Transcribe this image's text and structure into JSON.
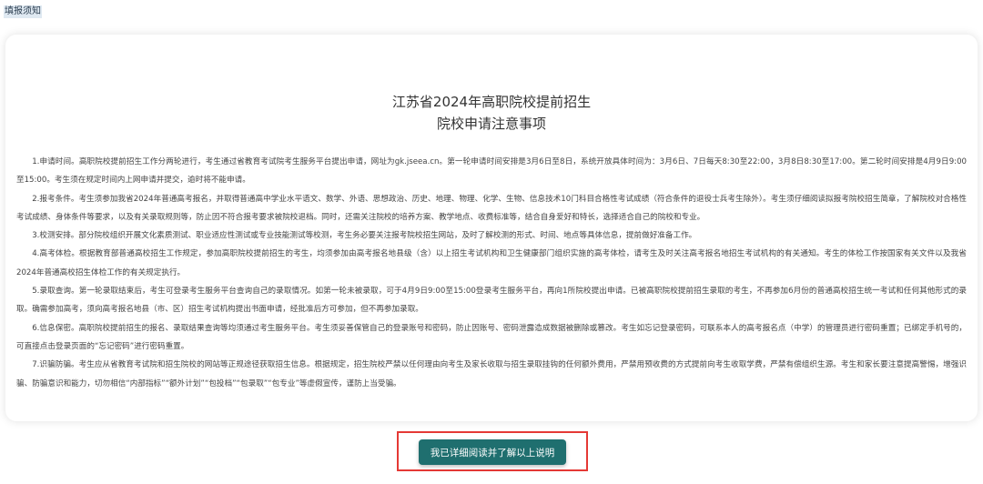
{
  "header": {
    "label": "填报须知"
  },
  "notice": {
    "title_line1": "江苏省2024年高职院校提前招生",
    "title_line2": "院校申请注意事项",
    "paragraphs": [
      "1.申请时间。高职院校提前招生工作分两轮进行，考生通过省教育考试院考生服务平台提出申请，网址为gk.jseea.cn。第一轮申请时间安排是3月6日至8日，系统开放具体时间为：3月6日、7日每天8:30至22:00，3月8日8:30至17:00。第二轮时间安排是4月9日9:00至15:00。考生须在规定时间内上网申请并提交，逾时将不能申请。",
      "2.报考条件。考生须参加我省2024年普通高考报名，并取得普通高中学业水平语文、数学、外语、思想政治、历史、地理、物理、化学、生物、信息技术10门科目合格性考试成绩（符合条件的退役士兵考生除外）。考生须仔细阅读拟报考院校招生简章，了解院校对合格性考试成绩、身体条件等要求，以及有关录取规则等，防止因不符合报考要求被院校退档。同时，还需关注院校的培养方案、教学地点、收费标准等，结合自身爱好和特长，选择适合自己的院校和专业。",
      "3.校测安排。部分院校组织开展文化素质测试、职业适应性测试或专业技能测试等校测，考生务必要关注报考院校招生网站，及时了解校测的形式、时间、地点等具体信息，提前做好准备工作。",
      "4.高考体检。根据教育部普通高校招生工作规定，参加高职院校提前招生的考生，均须参加由高考报名地县级（含）以上招生考试机构和卫生健康部门组织实施的高考体检，请考生及时关注高考报名地招生考试机构的有关通知。考生的体检工作按国家有关文件以及我省2024年普通高校招生体检工作的有关规定执行。",
      "5.录取查询。第一轮录取结束后，考生可登录考生服务平台查询自己的录取情况。如第一轮未被录取，可于4月9日9:00至15:00登录考生服务平台，再向1所院校提出申请。已被高职院校提前招生录取的考生，不再参加6月份的普通高校招生统一考试和任何其他形式的录取。确需参加高考，须向高考报名地县（市、区）招生考试机构提出书面申请，经批准后方可参加，但不再参加录取。",
      "6.信息保密。高职院校提前招生的报名、录取结果查询等均须通过考生服务平台。考生须妥善保管自己的登录账号和密码，防止因账号、密码泄露造成数据被删除或篡改。考生如忘记登录密码，可联系本人的高考报名点（中学）的管理员进行密码重置；已绑定手机号的，可直接点击登录页面的“忘记密码”进行密码重置。",
      "7.识骗防骗。考生应从省教育考试院和招生院校的网站等正规途径获取招生信息。根据规定，招生院校严禁以任何理由向考生及家长收取与招生录取挂钩的任何额外费用，严禁用预收费的方式提前向考生收取学费，严禁有偿组织生源。考生和家长要注意提高警惕，增强识骗、防骗意识和能力，切勿相信“内部指标”“额外计划”“包投档”“包录取”“包专业”等虚假宣传，谨防上当受骗。"
    ]
  },
  "actions": {
    "confirm_label": "我已详细阅读并了解以上说明"
  },
  "colors": {
    "button_bg": "#1f6f6f",
    "highlight_border": "#e53935"
  }
}
